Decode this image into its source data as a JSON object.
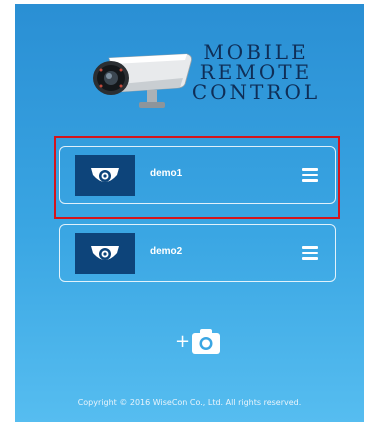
{
  "logo": {
    "line1": "MOBILE",
    "line2": "REMOTE",
    "line3": "CONTROL",
    "icon": "security-camera-icon"
  },
  "devices": [
    {
      "name": "demo1",
      "icon": "camera-thumb-icon",
      "menu_icon": "hamburger-menu-icon",
      "selected": true
    },
    {
      "name": "demo2",
      "icon": "camera-thumb-icon",
      "menu_icon": "hamburger-menu-icon",
      "selected": false
    }
  ],
  "actions": {
    "add_camera_plus": "+",
    "add_camera_icon": "camera-add-icon"
  },
  "footer": {
    "copyright": "Copyright © 2016 WiseCon Co., Ltd. All rights reserved."
  },
  "colors": {
    "background_top": "#2a8fd4",
    "background_bottom": "#56bdf0",
    "thumb_bg": "#0d447a",
    "logo_text": "#0f2e57",
    "selection_outline": "#d4141c"
  }
}
